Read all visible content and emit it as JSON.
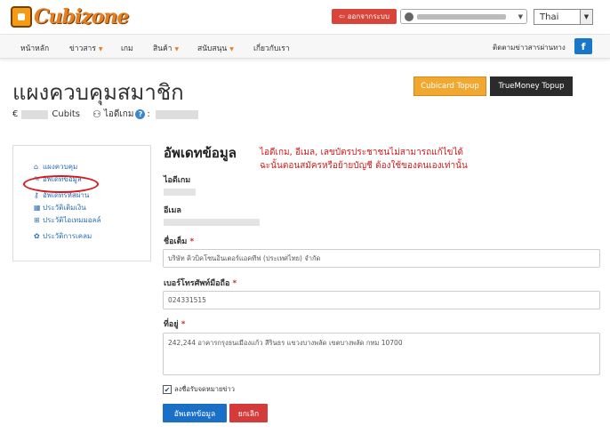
{
  "brand": {
    "logo_text": "Cubizone"
  },
  "topbar": {
    "logout_label": "ออกจากระบบ",
    "language": "Thai"
  },
  "nav": {
    "items": [
      {
        "label": "หน้าหลัก",
        "dropdown": false
      },
      {
        "label": "ข่าวสาร",
        "dropdown": true
      },
      {
        "label": "เกม",
        "dropdown": false
      },
      {
        "label": "สินค้า",
        "dropdown": true
      },
      {
        "label": "สนับสนุน",
        "dropdown": true
      },
      {
        "label": "เกี่ยวกับเรา",
        "dropdown": false
      }
    ],
    "follow_label": "ติดตามข่าวสารผ่านทาง",
    "facebook_label": "f"
  },
  "header": {
    "title": "แผงควบคุมสมาชิก",
    "currency_symbol": "€",
    "cubits_label": "Cubits",
    "game_id_label": "ไอดีเกม",
    "help_label": "?",
    "cubicard_button": "Cubicard Topup",
    "truemoney_button": "TrueMoney Topup"
  },
  "sidebar": {
    "items": [
      {
        "label": "แผงควบคุม",
        "icon": "home-icon"
      },
      {
        "label": "อัพเดทข้อมูล",
        "icon": "edit-icon"
      },
      {
        "label": "อัพเดทรหัสผ่าน",
        "icon": "key-icon"
      },
      {
        "label": "ประวัติเติมเงิน",
        "icon": "calendar-icon"
      },
      {
        "label": "ประวัติไอเทมมอลล์",
        "icon": "cart-icon"
      },
      {
        "label": "ประวัติการเคลม",
        "icon": "gift-icon"
      }
    ]
  },
  "form": {
    "title": "อัพเดทข้อมูล",
    "note_line1": "ไอดีเกม, อีเมล, เลขบัตรประชาชนไม่สามารถแก้ไขได้",
    "note_line2": "ฉะนั้นตอนสมัครหรือย้ายบัญชี ต้องใช้ของตนเองเท่านั้น",
    "game_id_label": "ไอดีเกม",
    "email_label": "อีเมล",
    "name_label": "ชื่อเต็ม",
    "name_value": "บริษัท คิวบิคโซนอินเตอร์แอคทีฟ (ประเทศไทย) จำกัด",
    "phone_label": "เบอร์โทรศัพท์มือถือ",
    "phone_value": "024331515",
    "address_label": "ที่อยู่",
    "address_value": "242,244 อาคารกรุงธนเมืองแก้ว สีรินธร แขวงบางพลัด เขตบางพลัด กทม 10700",
    "required_mark": "*",
    "newsletter_label": "ลงชื่อรับจดหมายข่าว",
    "newsletter_checked": true,
    "update_button": "อัพเดทข้อมูล",
    "cancel_button": "ยกเลิก"
  }
}
